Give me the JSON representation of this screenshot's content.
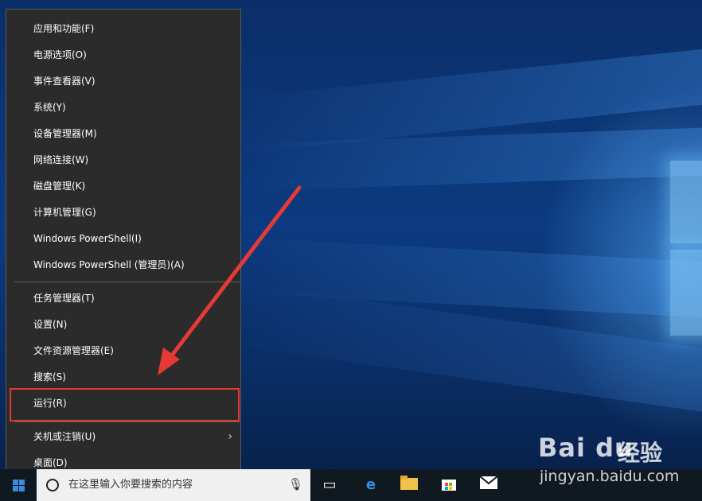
{
  "menu": {
    "items": [
      {
        "label": "应用和功能(F)"
      },
      {
        "label": "电源选项(O)"
      },
      {
        "label": "事件查看器(V)"
      },
      {
        "label": "系统(Y)"
      },
      {
        "label": "设备管理器(M)"
      },
      {
        "label": "网络连接(W)"
      },
      {
        "label": "磁盘管理(K)"
      },
      {
        "label": "计算机管理(G)"
      },
      {
        "label": "Windows PowerShell(I)"
      },
      {
        "label": "Windows PowerShell (管理员)(A)"
      },
      {
        "label": "任务管理器(T)"
      },
      {
        "label": "设置(N)"
      },
      {
        "label": "文件资源管理器(E)"
      },
      {
        "label": "搜索(S)"
      },
      {
        "label": "运行(R)"
      },
      {
        "label": "关机或注销(U)"
      },
      {
        "label": "桌面(D)"
      }
    ],
    "highlighted_item": "运行(R)"
  },
  "taskbar": {
    "search_placeholder": "在这里输入你要搜索的内容",
    "icons": [
      "windows-start-icon",
      "search-circle-icon",
      "microphone-icon",
      "task-view-icon",
      "edge-icon",
      "file-explorer-icon",
      "store-icon",
      "mail-icon"
    ]
  },
  "watermark": {
    "logo": "Bai du",
    "brand_cn": "经验",
    "url": "jingyan.baidu.com"
  },
  "colors": {
    "menu_bg": "#2b2b2b",
    "highlight_border": "#e53935",
    "arrow": "#e53935",
    "taskbar_bg": "#101820",
    "desktop_accent": "#3a8be0"
  }
}
